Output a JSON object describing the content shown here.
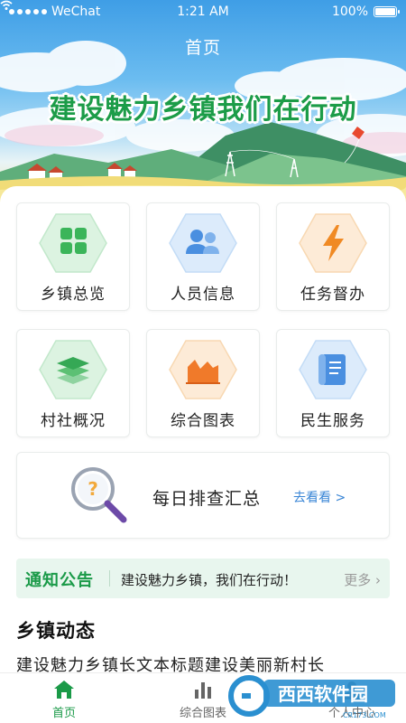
{
  "status_bar": {
    "carrier": "WeChat",
    "time": "1:21 AM",
    "battery": "100%"
  },
  "nav": {
    "title": "首页"
  },
  "banner": {
    "slogan": "建设魅力乡镇我们在行动"
  },
  "tiles": [
    {
      "label": "乡镇总览",
      "icon": "grid-icon",
      "color": "#3bb55a",
      "bg": "#dcf3e1"
    },
    {
      "label": "人员信息",
      "icon": "users-icon",
      "color": "#4a8fe0",
      "bg": "#dcebfb"
    },
    {
      "label": "任务督办",
      "icon": "lightning-icon",
      "color": "#f08a24",
      "bg": "#fdebd7"
    },
    {
      "label": "村社概况",
      "icon": "layers-icon",
      "color": "#35a855",
      "bg": "#dcf3e1"
    },
    {
      "label": "综合图表",
      "icon": "area-chart-icon",
      "color": "#f07a2a",
      "bg": "#fdebd7"
    },
    {
      "label": "民生服务",
      "icon": "scroll-icon",
      "color": "#4a8fe0",
      "bg": "#dcebfb"
    }
  ],
  "daily": {
    "title": "每日排查汇总",
    "link": "去看看 >",
    "icon": "magnifier-question-icon"
  },
  "notice": {
    "tag": "通知公告",
    "text": "建设魅力乡镇，我们在行动！",
    "more": "更多 ›"
  },
  "news": {
    "heading": "乡镇动态",
    "first_item": "建设魅力乡镇长文本标题建设美丽新村长"
  },
  "tabbar": {
    "home": {
      "label": "首页",
      "icon": "home-icon"
    },
    "charts": {
      "label": "综合图表",
      "icon": "bar-chart-icon"
    },
    "me": {
      "label": "个人中心",
      "icon": "user-icon"
    }
  },
  "watermark": {
    "text": "西西软件园",
    "sub": "CR173.COM"
  },
  "colors": {
    "primary": "#1a9a48",
    "link": "#3a86d6",
    "notice_bg": "#e8f6ee"
  }
}
